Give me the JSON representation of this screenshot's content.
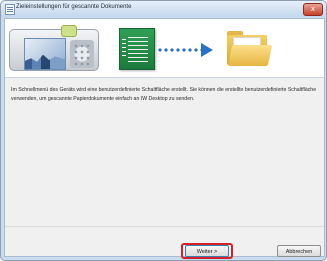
{
  "window": {
    "title": "Zieleinstellungen für gescannte Dokumente",
    "close_glyph": "x"
  },
  "banner": {
    "icons": [
      "device-icon",
      "document-icon",
      "arrow-icon",
      "folder-icon"
    ],
    "colors": {
      "document": "#1d7a3d",
      "arrow": "#2b6fc6",
      "folder": "#e5b74a"
    }
  },
  "main": {
    "description": "Im Schnellmenü des Geräts wird eine benutzerdefinierte Schaltfläche erstellt. Sie können die erstellte benutzerdefinierte Schaltfläche verwenden, um gescannte Papierdokumente einfach an IW Desktop zu senden."
  },
  "footer": {
    "next_label": "Weiter >",
    "cancel_label": "Abbrechen",
    "highlight_color": "#d3202a"
  }
}
